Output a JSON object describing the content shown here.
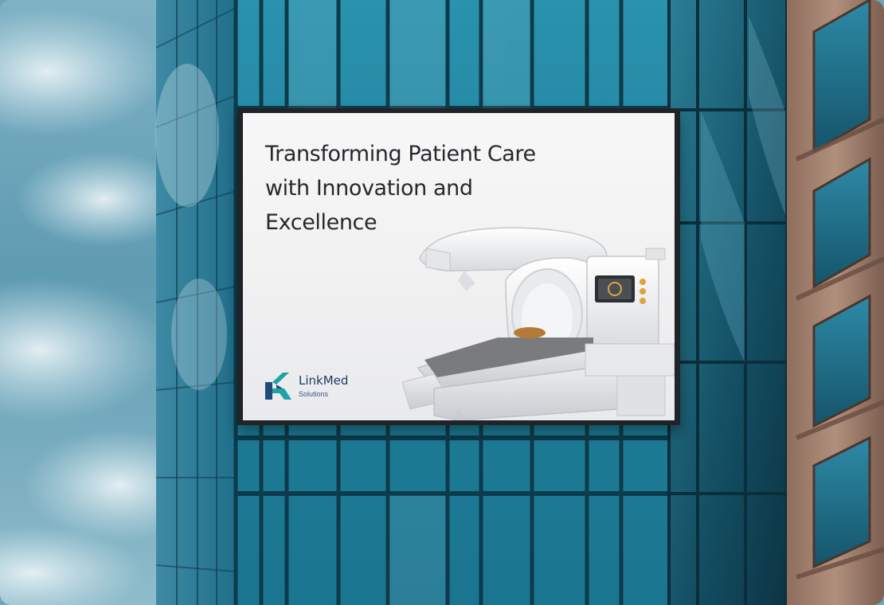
{
  "billboard": {
    "headline_line_1": "Transforming Patient Care",
    "headline_line_2": "with Innovation and",
    "headline_line_3": "Excellence",
    "brand_name": "LinkMed",
    "brand_tagline": "Solutions"
  },
  "colors": {
    "glass_teal": "#1f7f9a",
    "glass_dark": "#0f4a5e",
    "sky_blue": "#6fa4b9",
    "brick_tan": "#a88470",
    "logo_teal": "#1fa3a5",
    "logo_navy": "#1f4a7a",
    "headline_text": "#26282d",
    "brand_text": "#1e3a66"
  },
  "icons": {
    "logo": "linkmed-logo-icon"
  }
}
